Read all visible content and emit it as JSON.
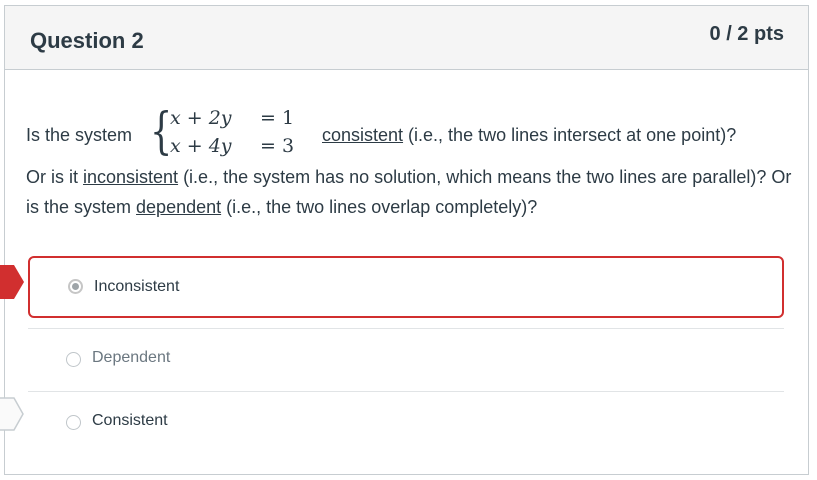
{
  "question": {
    "title": "Question 2",
    "points": "0 / 2 pts",
    "intro": "Is the system",
    "equations": [
      {
        "lhs": "x + 2y",
        "rhs": "= 1"
      },
      {
        "lhs": "x + 4y",
        "rhs": "= 3"
      }
    ],
    "after_system": {
      "term": "consistent",
      "rest": " (i.e., the two lines intersect at one point)?"
    },
    "paragraph": {
      "p1": "Or is it ",
      "term1": "inconsistent",
      "p2": " (i.e., the system has no solution, which means the two lines are parallel)? Or is the system ",
      "term2": "dependent",
      "p3": " (i.e., the two lines overlap completely)?"
    }
  },
  "answers": [
    {
      "label": "Inconsistent",
      "selected": true
    },
    {
      "label": "Dependent",
      "selected": false
    },
    {
      "label": "Consistent",
      "selected": false
    }
  ],
  "colors": {
    "incorrect_marker": "#d12f2f",
    "correct_marker": "#e9ecee",
    "selected_border": "#d12f2f"
  }
}
